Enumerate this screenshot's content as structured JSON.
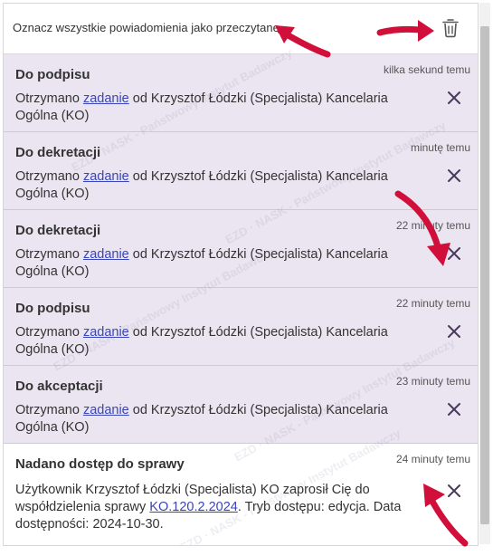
{
  "header": {
    "mark_all_label": "Oznacz wszystkie powiadomienia jako przeczytane",
    "delete_icon": "trash-icon"
  },
  "notifications": [
    {
      "title": "Do podpisu",
      "time": "kilka sekund temu",
      "prefix": "Otrzymano ",
      "link": "zadanie",
      "suffix": " od Krzysztof Łódzki (Specjalista) Kancelaria Ogólna (KO)"
    },
    {
      "title": "Do dekretacji",
      "time": "minutę temu",
      "prefix": "Otrzymano ",
      "link": "zadanie",
      "suffix": " od Krzysztof Łódzki (Specjalista) Kancelaria Ogólna (KO)"
    },
    {
      "title": "Do dekretacji",
      "time": "22 minuty temu",
      "prefix": "Otrzymano ",
      "link": "zadanie",
      "suffix": " od Krzysztof Łódzki (Specjalista) Kancelaria Ogólna (KO)"
    },
    {
      "title": "Do podpisu",
      "time": "22 minuty temu",
      "prefix": "Otrzymano ",
      "link": "zadanie",
      "suffix": " od Krzysztof Łódzki (Specjalista) Kancelaria Ogólna (KO)"
    },
    {
      "title": "Do akceptacji",
      "time": "23 minuty temu",
      "prefix": "Otrzymano ",
      "link": "zadanie",
      "suffix": " od Krzysztof Łódzki (Specjalista) Kancelaria Ogólna (KO)"
    },
    {
      "title": "Nadano dostęp do sprawy",
      "time": "24 minuty temu",
      "prefix": "Użytkownik Krzysztof Łódzki (Specjalista) KO zaprosił Cię do współdzielenia sprawy ",
      "link": "KO.120.2.2024",
      "suffix": ". Tryb dostępu: edycja. Data dostępności: 2024-10-30."
    }
  ],
  "watermark_text": "NASK - Państwowy Instytut Badawczy",
  "watermark_logo": "EZD",
  "colors": {
    "unread_bg": "#ebe5f1",
    "link": "#3a45b8",
    "annotation_arrow": "#d0103a",
    "close_icon": "#4a3a5c"
  },
  "icons": {
    "close": "close-icon",
    "annotation": "annotation-arrow-icon"
  }
}
